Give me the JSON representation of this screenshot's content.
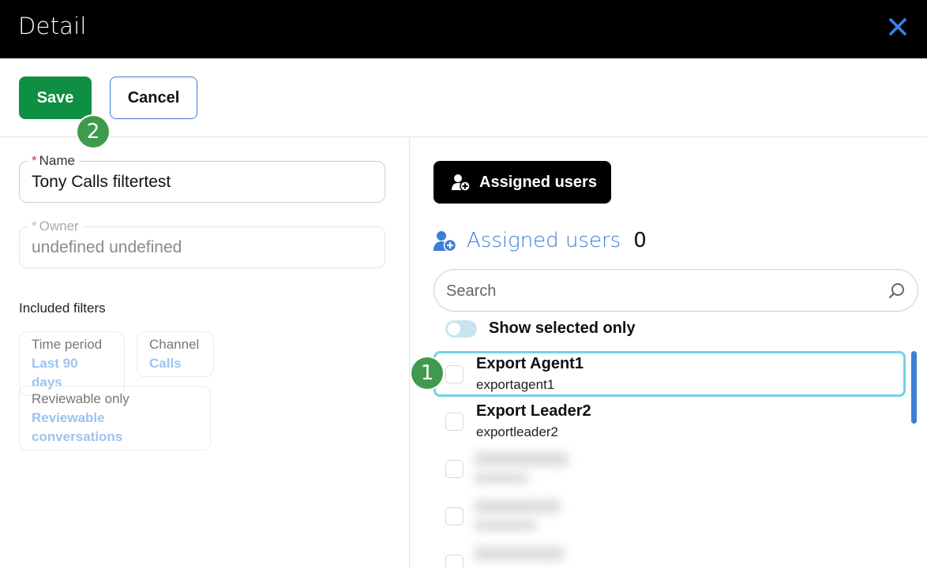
{
  "window": {
    "title": "Detail",
    "close_icon": "close-icon",
    "accent": "#3b7fd6"
  },
  "toolbar": {
    "save_label": "Save",
    "cancel_label": "Cancel",
    "save_color": "#0f8f43"
  },
  "markers": {
    "save_marker": "2",
    "row_marker": "1"
  },
  "form": {
    "name": {
      "required_mark": "*",
      "label": "Name",
      "value": "Tony Calls filtertest"
    },
    "owner": {
      "required_mark": "*",
      "label": "Owner",
      "value": "undefined undefined"
    }
  },
  "filters": {
    "title": "Included filters",
    "items": [
      {
        "key": "Time period",
        "value": "Last 90 days"
      },
      {
        "key": "Channel",
        "value": "Calls"
      },
      {
        "key": "Reviewable only",
        "value": "Reviewable conversations"
      }
    ]
  },
  "assigned": {
    "button_label": "Assigned users",
    "heading": "Assigned users",
    "count": "0",
    "search_placeholder": "Search",
    "show_selected_label": "Show selected only",
    "users": [
      {
        "name": "Export Agent1",
        "login": "exportagent1",
        "checked": false,
        "focused": true
      },
      {
        "name": "Export Leader2",
        "login": "exportleader2",
        "checked": false,
        "focused": false
      }
    ]
  }
}
